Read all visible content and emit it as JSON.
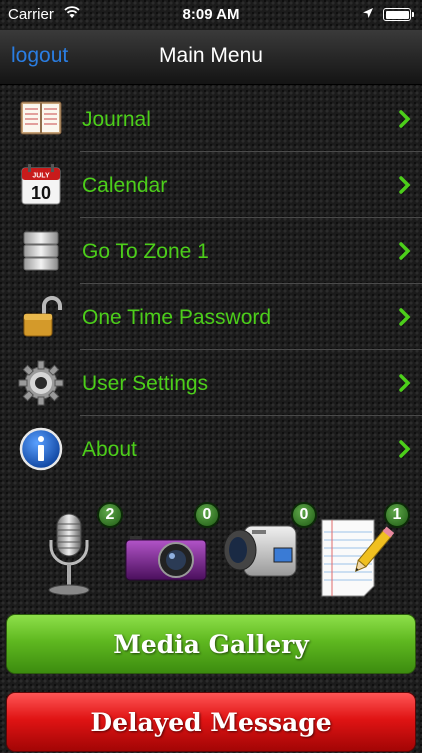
{
  "status_bar": {
    "carrier": "Carrier",
    "time": "8:09 AM"
  },
  "nav": {
    "logout_label": "logout",
    "title": "Main Menu"
  },
  "menu": {
    "items": [
      {
        "label": "Journal",
        "icon": "journal-icon"
      },
      {
        "label": "Calendar",
        "icon": "calendar-icon",
        "calendar_month": "JULY",
        "calendar_day": "10"
      },
      {
        "label": "Go To Zone 1",
        "icon": "database-icon"
      },
      {
        "label": "One Time Password",
        "icon": "padlock-icon"
      },
      {
        "label": "User Settings",
        "icon": "gear-icon"
      },
      {
        "label": "About",
        "icon": "info-icon"
      }
    ]
  },
  "media": {
    "microphone_count": "2",
    "camera_count": "0",
    "video_count": "0",
    "note_count": "1"
  },
  "buttons": {
    "media_gallery": "Media Gallery",
    "delayed_message": "Delayed Message"
  },
  "colors": {
    "menu_text": "#4cce1a",
    "logout_link": "#2a7de1",
    "green_button": "#5fb820",
    "red_button": "#e01414"
  }
}
